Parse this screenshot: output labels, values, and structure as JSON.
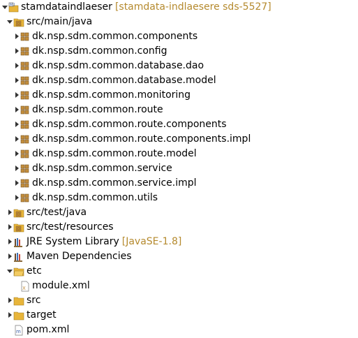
{
  "tree": {
    "project": {
      "label": "stamdataindlaeser",
      "decoration": "[stamdata-indlaesere sds-5527]",
      "expanded": true,
      "icon": "maven-project-icon"
    },
    "src_main_java": {
      "label": "src/main/java",
      "expanded": true,
      "icon": "source-folder-icon"
    },
    "packages": [
      {
        "label": "dk.nsp.sdm.common.components",
        "icon": "package-icon"
      },
      {
        "label": "dk.nsp.sdm.common.config",
        "icon": "package-icon"
      },
      {
        "label": "dk.nsp.sdm.common.database.dao",
        "icon": "package-icon"
      },
      {
        "label": "dk.nsp.sdm.common.database.model",
        "icon": "package-icon"
      },
      {
        "label": "dk.nsp.sdm.common.monitoring",
        "icon": "package-icon"
      },
      {
        "label": "dk.nsp.sdm.common.route",
        "icon": "package-icon"
      },
      {
        "label": "dk.nsp.sdm.common.route.components",
        "icon": "package-icon"
      },
      {
        "label": "dk.nsp.sdm.common.route.components.impl",
        "icon": "package-icon"
      },
      {
        "label": "dk.nsp.sdm.common.route.model",
        "icon": "package-icon"
      },
      {
        "label": "dk.nsp.sdm.common.service",
        "icon": "package-icon"
      },
      {
        "label": "dk.nsp.sdm.common.service.impl",
        "icon": "package-icon"
      },
      {
        "label": "dk.nsp.sdm.common.utils",
        "icon": "package-icon"
      }
    ],
    "src_test_java": {
      "label": "src/test/java",
      "icon": "source-folder-icon"
    },
    "src_test_resources": {
      "label": "src/test/resources",
      "icon": "source-folder-icon"
    },
    "jre_library": {
      "label": "JRE System Library",
      "decoration": "[JavaSE-1.8]",
      "icon": "library-icon"
    },
    "maven_dependencies": {
      "label": "Maven Dependencies",
      "icon": "library-icon"
    },
    "etc": {
      "label": "etc",
      "expanded": true,
      "icon": "folder-icon"
    },
    "module_xml": {
      "label": "module.xml",
      "icon": "xml-file-icon"
    },
    "src": {
      "label": "src",
      "icon": "folder-icon"
    },
    "target": {
      "label": "target",
      "icon": "folder-icon"
    },
    "pom_xml": {
      "label": "pom.xml",
      "icon": "maven-pom-icon"
    }
  },
  "colors": {
    "decoration": "#b58a2e",
    "folder": "#e8b53a",
    "package": "#c28d3c",
    "arrow": "#333333"
  }
}
